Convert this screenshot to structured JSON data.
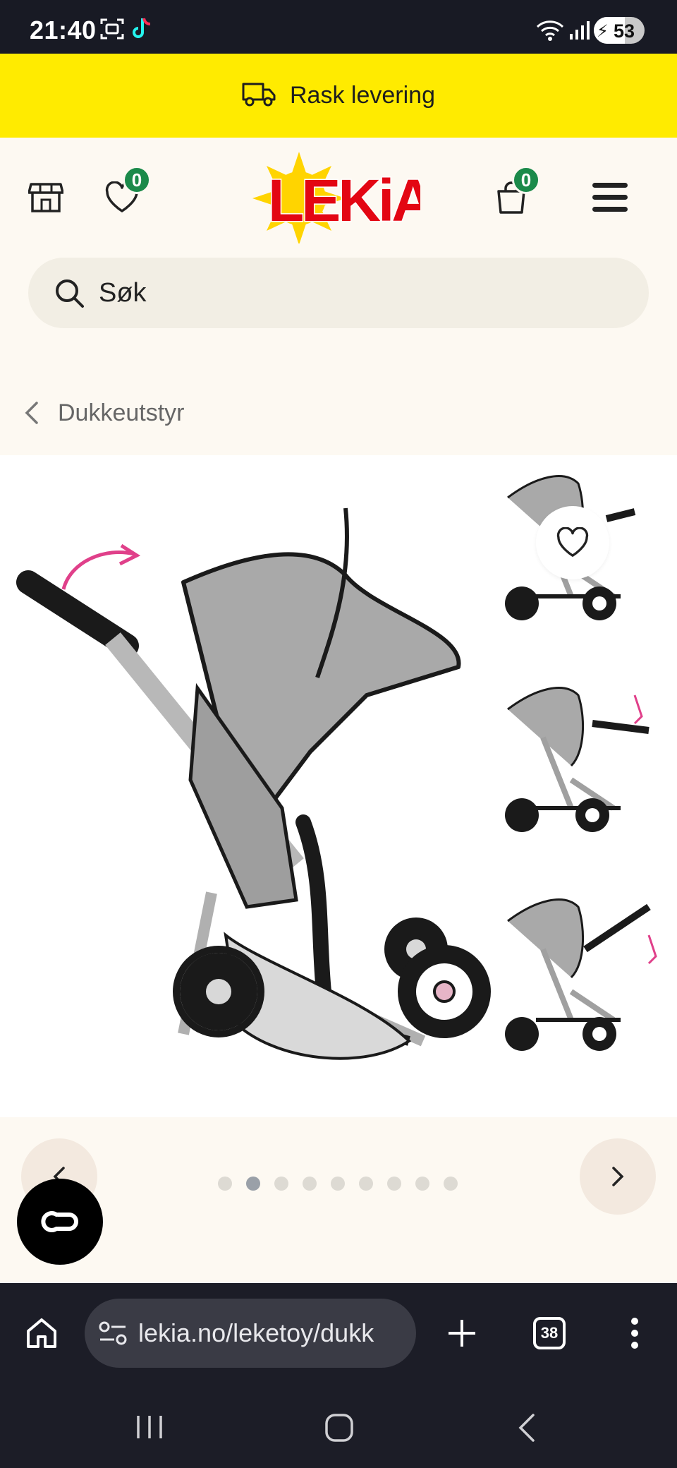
{
  "status_bar": {
    "time": "21:40",
    "battery": "53"
  },
  "promo": {
    "text": "Rask levering",
    "icon": "truck-icon"
  },
  "header": {
    "logo_text": "LEKiA",
    "wishlist_count": "0",
    "cart_count": "0",
    "icons": [
      "store-icon",
      "heart-icon",
      "bag-icon",
      "menu-icon"
    ]
  },
  "search": {
    "placeholder": "Søk"
  },
  "breadcrumb": {
    "label": "Dukkeutstyr"
  },
  "gallery": {
    "active_index": 2,
    "total": 9
  },
  "browser": {
    "url": "lekia.no/leketoy/dukk",
    "tab_count": "38"
  },
  "colors": {
    "promo": "#ffeb00",
    "badge": "#1b8a4a",
    "logo_red": "#e30613",
    "logo_sun": "#ffd400"
  }
}
